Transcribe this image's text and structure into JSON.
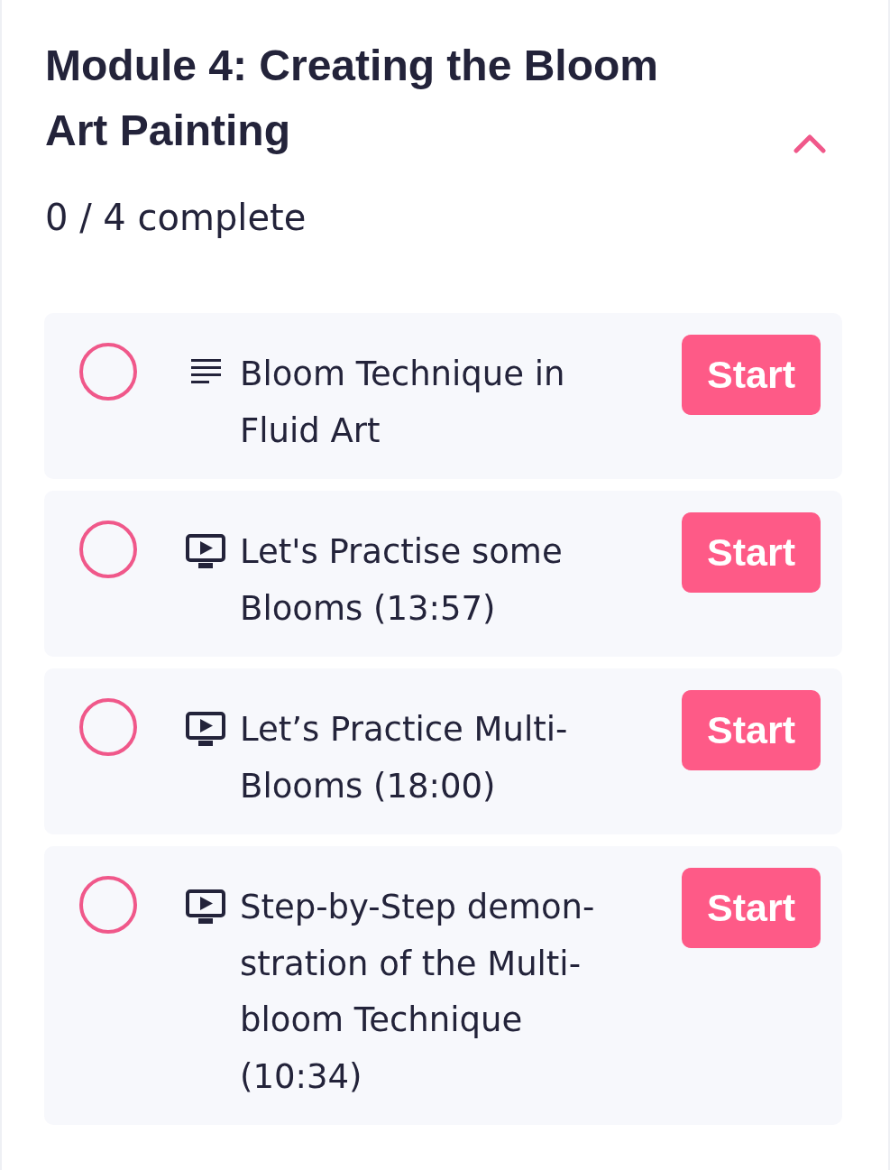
{
  "module": {
    "title": "Module 4: Creating the Bloom Art Painting",
    "expanded": true,
    "progress": "0 / 4 complete"
  },
  "lessons": [
    {
      "kind": "text",
      "title": "Bloom Technique in Fluid Art",
      "completed": false,
      "action": "Start"
    },
    {
      "kind": "video",
      "title": "Let's Practise some Blooms (13:57)",
      "completed": false,
      "action": "Start"
    },
    {
      "kind": "video",
      "title": "Let’s Practice Multi-Blooms (18:00)",
      "completed": false,
      "action": "Start"
    },
    {
      "kind": "video",
      "title": "Step-by-Step demon-stration of the Multi-bloom Technique (10:34)",
      "completed": false,
      "action": "Start"
    }
  ]
}
